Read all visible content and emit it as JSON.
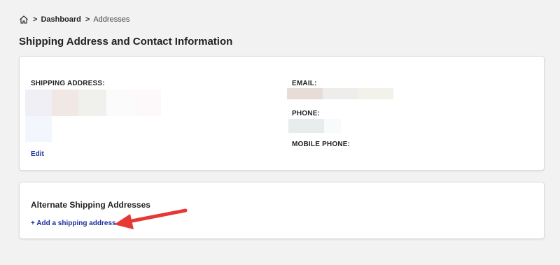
{
  "breadcrumb": {
    "home_icon": "home-icon",
    "separator": ">",
    "dashboard": "Dashboard",
    "current": "Addresses"
  },
  "page": {
    "title": "Shipping Address and Contact Information"
  },
  "contact_card": {
    "shipping_label": "SHIPPING ADDRESS:",
    "email_label": "EMAIL:",
    "phone_label": "PHONE:",
    "mobile_label": "MOBILE PHONE:",
    "edit_label": "Edit"
  },
  "alternate_card": {
    "title": "Alternate Shipping Addresses",
    "add_label": "+ Add a shipping address"
  },
  "colors": {
    "link": "#1a2e9b",
    "arrow": "#e53935",
    "background": "#f2f2f3"
  }
}
